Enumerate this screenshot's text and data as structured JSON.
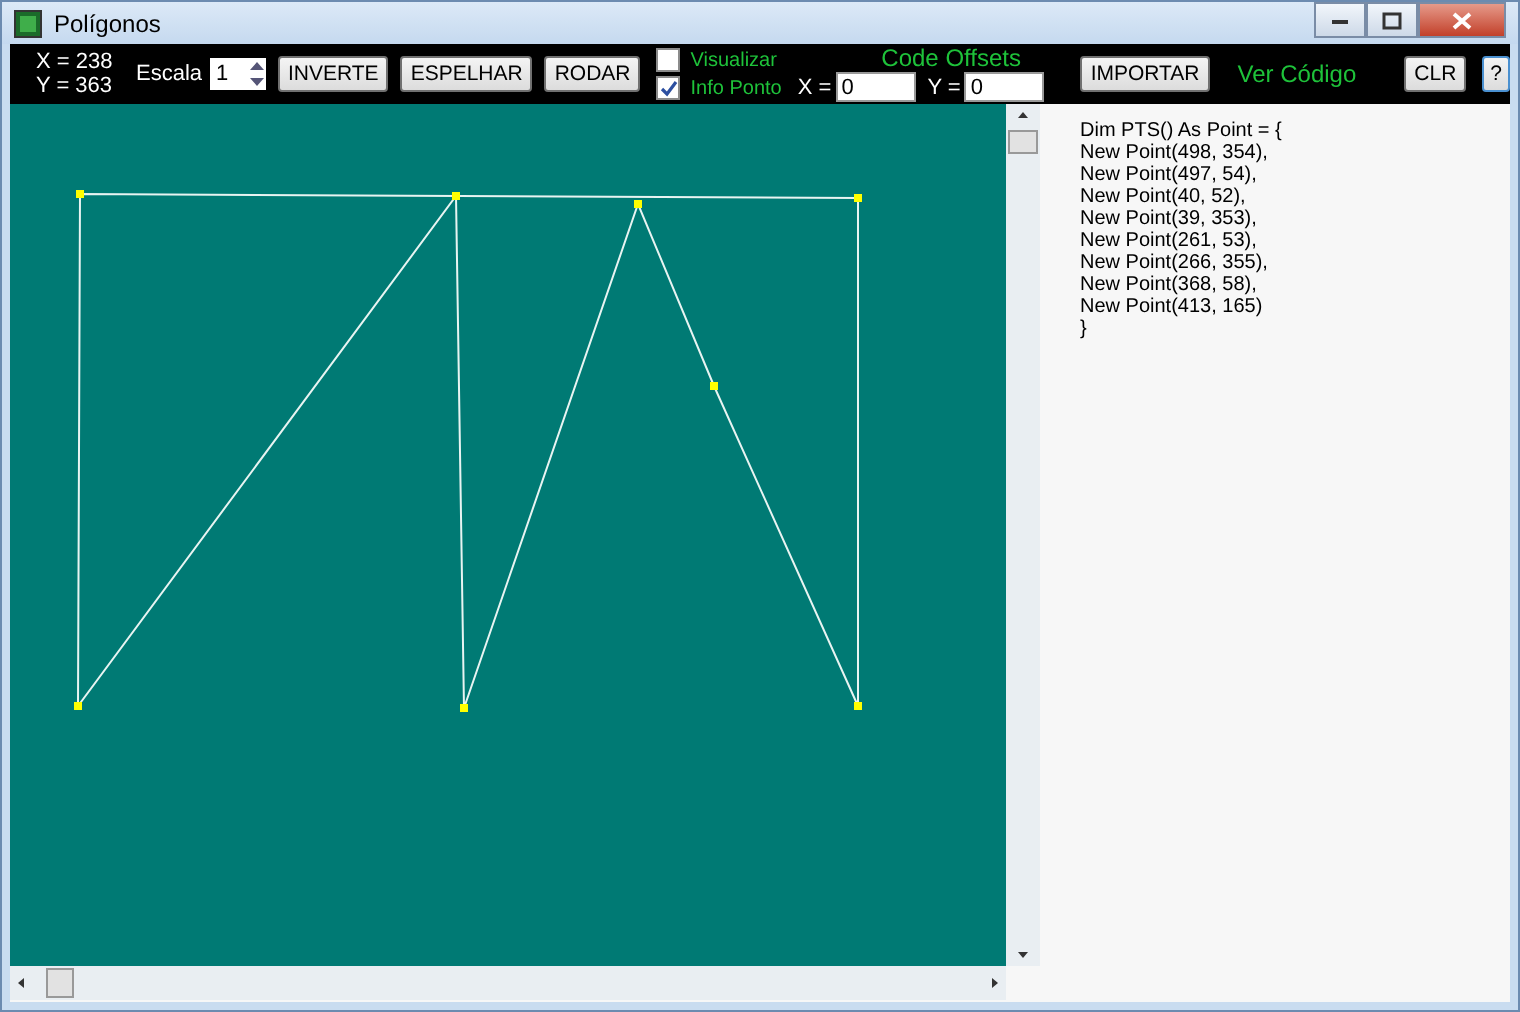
{
  "window": {
    "title": "Polígonos"
  },
  "toolbar": {
    "coords": [
      "X = 238",
      "Y = 363"
    ],
    "scale_label": "Escala",
    "scale_value": "1",
    "buttons": [
      "INVERTE",
      "ESPELHAR",
      "RODAR"
    ],
    "checkboxes": [
      {
        "label": "Visualizar",
        "checked": false
      },
      {
        "label": "Info Ponto",
        "checked": true
      }
    ],
    "offsets": {
      "title": "Code Offsets",
      "fields": [
        {
          "label": "X =",
          "value": "0"
        },
        {
          "label": "Y =",
          "value": "0"
        }
      ]
    },
    "import_button": "IMPORTAR",
    "code_label": "Ver Código",
    "clear_button": "CLR",
    "help_button": "?"
  },
  "code": [
    "Dim PTS() As Point = {",
    "New Point(498, 354),",
    "New Point(497, 54),",
    "New Point(40, 52),",
    "New Point(39, 353),",
    "New Point(261, 53),",
    "New Point(266, 355),",
    "New Point(368, 58),",
    "New Point(413, 165)",
    "}"
  ]
}
